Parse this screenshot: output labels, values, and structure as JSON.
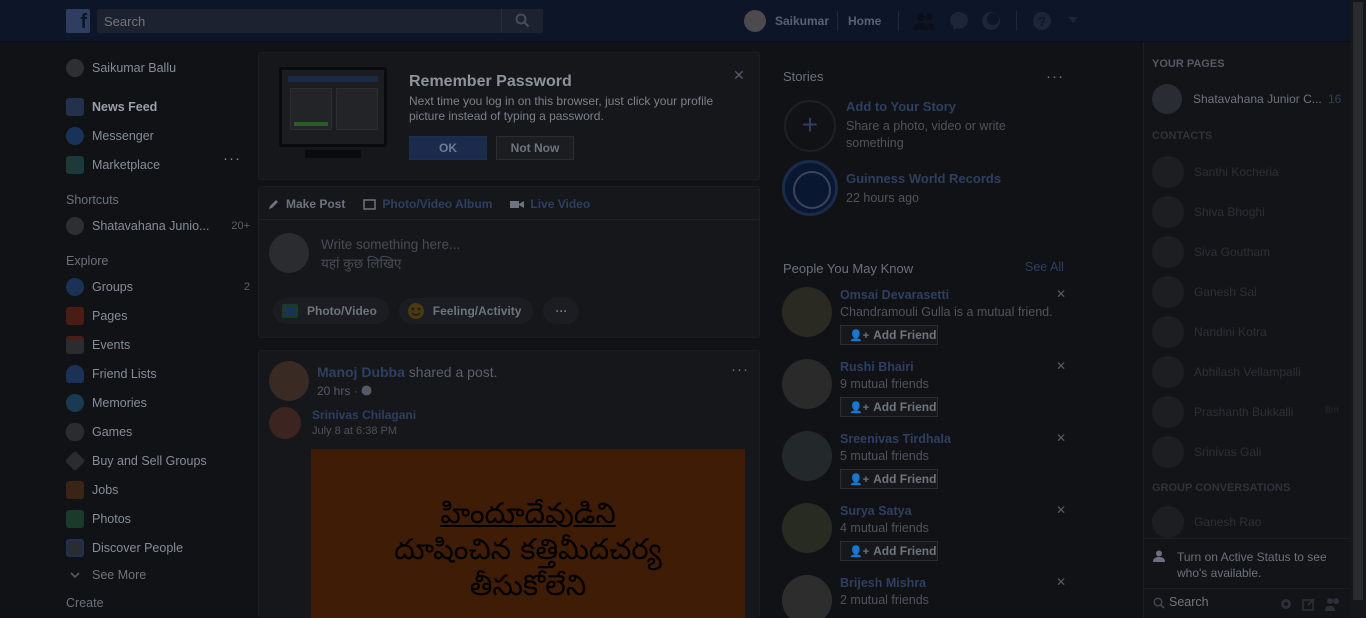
{
  "topbar": {
    "search_placeholder": "Search",
    "user_name": "Saikumar",
    "home_label": "Home"
  },
  "leftnav": {
    "profile_name": "Saikumar Ballu",
    "items": [
      {
        "label": "News Feed",
        "icon": "news-feed-icon",
        "color": "#23314c"
      },
      {
        "label": "Messenger",
        "icon": "messenger-icon",
        "color": "#1b3258"
      },
      {
        "label": "Marketplace",
        "icon": "marketplace-icon",
        "color": "#1c3a3a"
      }
    ],
    "shortcuts_title": "Shortcuts",
    "shortcut": {
      "label": "Shatavahana Junio...",
      "count": "20+"
    },
    "explore_title": "Explore",
    "explore": [
      {
        "label": "Groups",
        "icon": "groups-icon",
        "count": "2"
      },
      {
        "label": "Pages",
        "icon": "pages-icon"
      },
      {
        "label": "Events",
        "icon": "events-icon"
      },
      {
        "label": "Friend Lists",
        "icon": "friend-lists-icon"
      },
      {
        "label": "Memories",
        "icon": "memories-icon"
      },
      {
        "label": "Games",
        "icon": "games-icon"
      },
      {
        "label": "Buy and Sell Groups",
        "icon": "buy-sell-icon"
      },
      {
        "label": "Jobs",
        "icon": "jobs-icon"
      },
      {
        "label": "Photos",
        "icon": "photos-icon"
      },
      {
        "label": "Discover People",
        "icon": "discover-people-icon"
      }
    ],
    "see_more": "See More",
    "create_title": "Create"
  },
  "remember": {
    "title": "Remember Password",
    "text": "Next time you log in on this browser, just click your profile picture instead of typing a password.",
    "ok_label": "OK",
    "not_now_label": "Not Now"
  },
  "composer": {
    "tabs": [
      "Make Post",
      "Photo/Video Album",
      "Live Video"
    ],
    "placeholder_line1": "Write something here...",
    "placeholder_line2": "यहां कुछ लिखिए",
    "buttons": [
      "Photo/Video",
      "Feeling/Activity"
    ]
  },
  "post": {
    "author": "Manoj Dubba",
    "action": "shared a post.",
    "time": "20 hrs",
    "shared_author": "Srinivas Chilagani",
    "shared_time": "July 8 at 6:38 PM",
    "image_text_lines": [
      "హిందూదేవుడిని",
      "దూషించిన కత్తిమీదచర్య",
      "తీసుకోలేని"
    ]
  },
  "stories": {
    "title": "Stories",
    "add_title": "Add to Your Story",
    "add_sub": "Share a photo, video or write something",
    "item_title": "Guinness World Records",
    "item_time": "22 hours ago"
  },
  "pymk": {
    "title": "People You May Know",
    "see_all": "See All",
    "add_label": "Add Friend",
    "people": [
      {
        "name": "Omsai Devarasetti",
        "sub": "Chandramouli Gulla is a mutual friend."
      },
      {
        "name": "Rushi Bhairi",
        "sub": "9 mutual friends"
      },
      {
        "name": "Sreenivas Tirdhala",
        "sub": "5 mutual friends"
      },
      {
        "name": "Surya Satya",
        "sub": "4 mutual friends"
      },
      {
        "name": "Brijesh Mishra",
        "sub": "2 mutual friends"
      }
    ]
  },
  "chat": {
    "pages_title": "YOUR PAGES",
    "page_name": "Shatavahana Junior C...",
    "page_count": "16",
    "contacts_title": "CONTACTS",
    "contacts": [
      {
        "name": "Santhi Kocheria"
      },
      {
        "name": "Shiva Bhoghi"
      },
      {
        "name": "Siva Goutham"
      },
      {
        "name": "Ganesh Sai"
      },
      {
        "name": "Nandini Kotra"
      },
      {
        "name": "Abhilash Vellampalli"
      },
      {
        "name": "Prashanth Bukkalli",
        "meta": "8m"
      },
      {
        "name": "Srinivas Gali"
      }
    ],
    "group_title": "GROUP CONVERSATIONS",
    "group_item": "Ganesh Rao",
    "active_status": "Turn on Active Status to see who's available.",
    "search_placeholder": "Search"
  }
}
